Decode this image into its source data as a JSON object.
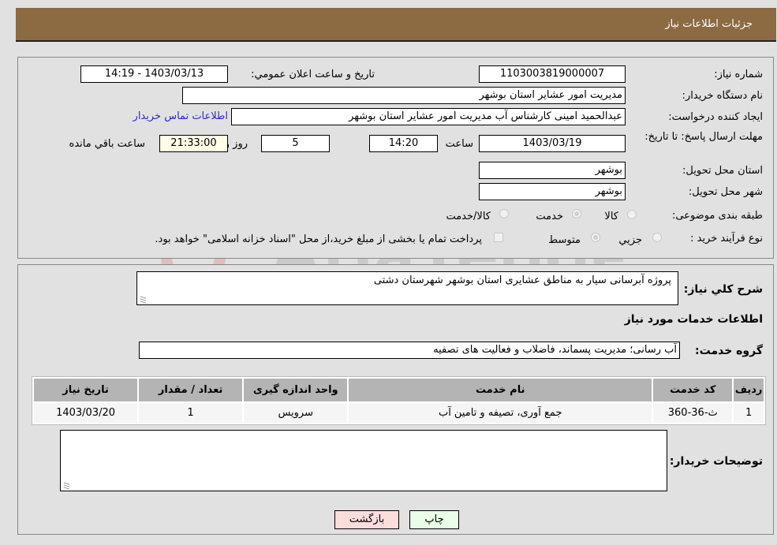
{
  "header": {
    "title": "جزئیات اطلاعات نیاز"
  },
  "fields": {
    "need_number_label": "شماره نیاز:",
    "need_number": "1103003819000007",
    "announce_label": "تاریخ و ساعت اعلان عمومي:",
    "announce_value": "1403/03/13 - 14:19",
    "buyer_org_label": "نام دستگاه خریدار:",
    "buyer_org": "مدیریت امور عشایر استان بوشهر",
    "requester_label": "ایجاد کننده درخواست:",
    "requester": "عبدالحمید امینی کارشناس آب مدیریت امور عشایر استان بوشهر",
    "contact_link": "اطلاعات تماس خریدار",
    "deadline_label": "مهلت ارسال پاسخ: تا تاریخ:",
    "deadline_date": "1403/03/19",
    "time_label": "ساعت",
    "deadline_time": "14:20",
    "days_value": "5",
    "days_label": "روز و",
    "remaining_time": "21:33:00",
    "remaining_label": "ساعت باقي مانده",
    "province_label": "استان محل تحویل:",
    "province": "بوشهر",
    "city_label": "شهر محل تحویل:",
    "city": "بوشهر",
    "category_label": "طبقه بندی موضوعی:",
    "category_options": [
      {
        "label": "کالا",
        "selected": false
      },
      {
        "label": "خدمت",
        "selected": true
      },
      {
        "label": "کالا/خدمت",
        "selected": false
      }
    ],
    "process_label": "نوع فرآیند خرید :",
    "process_options": [
      {
        "label": "جزيي",
        "selected": false
      },
      {
        "label": "متوسط",
        "selected": true
      }
    ],
    "treasury_note": "پرداخت تمام یا بخشی از مبلغ خرید،از محل \"اسناد خزانه اسلامی\" خواهد بود.",
    "treasury_checked": false
  },
  "description": {
    "label": "شرح کلي نیاز:",
    "value": "پروژه آبرسانی سیار به مناطق عشایری استان بوشهر شهرستان دشتی"
  },
  "services": {
    "section_title": "اطلاعات خدمات مورد نیاز",
    "group_label": "گروه خدمت:",
    "group_value": "آب رسانی؛ مدیریت پسماند، فاضلاب و فعالیت های تصفیه",
    "columns": [
      "ردیف",
      "کد خدمت",
      "نام خدمت",
      "واحد اندازه گیری",
      "تعداد / مقدار",
      "تاریخ نیاز"
    ],
    "rows": [
      {
        "row": "1",
        "code": "ث-36-360",
        "name": "جمع آوری، تصیفه و تامین آب",
        "unit": "سرویس",
        "qty": "1",
        "date": "1403/03/20"
      }
    ]
  },
  "buyer_notes": {
    "label": "توضیحات خریدار:",
    "value": ""
  },
  "buttons": {
    "print": "چاپ",
    "back": "بازگشت"
  },
  "watermark": {
    "text": "AriaTender.neT"
  }
}
